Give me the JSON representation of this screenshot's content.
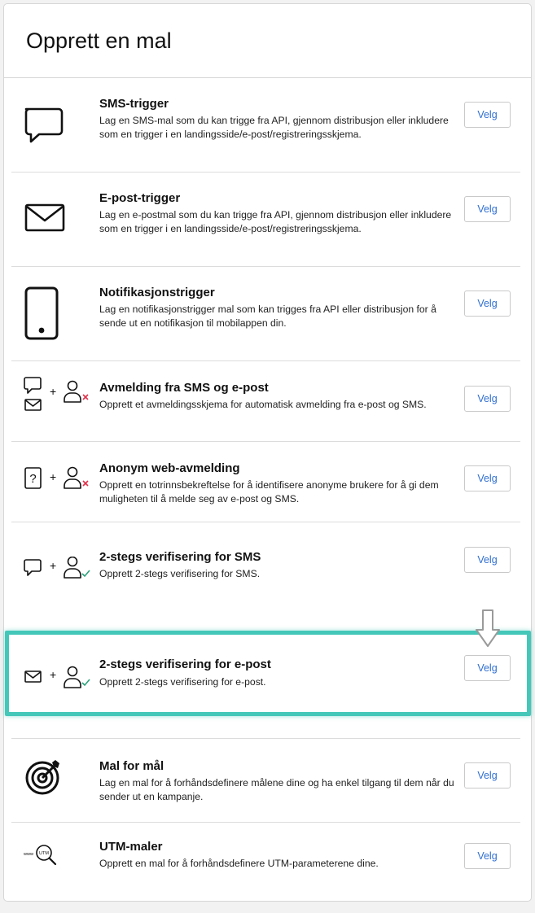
{
  "header": {
    "title": "Opprett en mal"
  },
  "button_label": "Velg",
  "icons": {
    "plus": "+",
    "utm_www": "www",
    "utm_badge": "UTM"
  },
  "items": [
    {
      "icon": "sms-icon",
      "title": "SMS-trigger",
      "desc": "Lag en SMS-mal som du kan trigge fra API, gjennom distribusjon eller inkludere som en trigger i en landingsside/e-post/registreringsskjema."
    },
    {
      "icon": "envelope-icon",
      "title": "E-post-trigger",
      "desc": "Lag en e-postmal som du kan trigge fra API, gjennom distribusjon eller inkludere som en trigger i en landingsside/e-post/registreringsskjema."
    },
    {
      "icon": "mobile-phone-icon",
      "title": "Notifikasjonstrigger",
      "desc": "Lag en notifikasjonstrigger mal som kan trigges fra API eller distribusjon for å sende ut en notifikasjon til mobilappen din."
    },
    {
      "icon": "sms-email-unsubscribe-icon",
      "title": "Avmelding fra SMS og e-post",
      "desc": "Opprett et avmeldingsskjema for automatisk avmelding fra e-post og SMS."
    },
    {
      "icon": "anonymous-unsubscribe-icon",
      "title": "Anonym web-avmelding",
      "desc": "Opprett en totrinnsbekreftelse for å identifisere anonyme brukere for å gi dem muligheten til å melde seg av e-post og SMS."
    },
    {
      "icon": "sms-verify-icon",
      "title": "2-stegs verifisering for SMS",
      "desc": "Opprett 2-stegs verifisering for SMS."
    },
    {
      "icon": "email-verify-icon",
      "title": "2-stegs verifisering for e-post",
      "desc": "Opprett 2-stegs verifisering for e-post."
    },
    {
      "icon": "target-icon",
      "title": "Mal for mål",
      "desc": "Lag en mal for å forhåndsdefinere målene dine og ha enkel tilgang til dem når du sender ut en kampanje."
    },
    {
      "icon": "utm-icon",
      "title": "UTM-maler",
      "desc": "Opprett en mal for å forhåndsdefinere UTM-parameterene dine."
    }
  ],
  "colors": {
    "highlight": "#44c7b8",
    "button_text": "#2f6fd1",
    "cross": "#e0314a",
    "check": "#2aa07a"
  }
}
